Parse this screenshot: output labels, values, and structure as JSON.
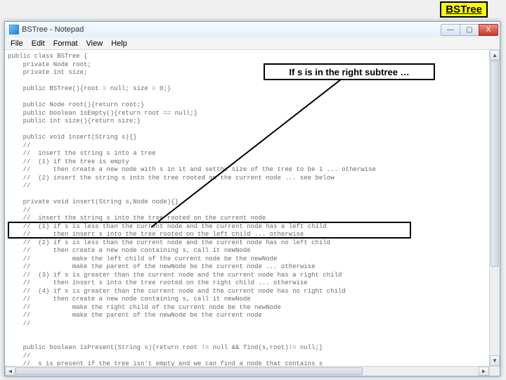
{
  "badge": "BSTree",
  "titlebar": {
    "title": "BSTree - Notepad"
  },
  "menu": {
    "file": "File",
    "edit": "Edit",
    "format": "Format",
    "view": "View",
    "help": "Help"
  },
  "winbuttons": {
    "min": "—",
    "max": "▢",
    "close": "X"
  },
  "annotation": "If s is in the right subtree …",
  "scroll": {
    "up": "▲",
    "down": "▼",
    "left": "◄",
    "right": "►"
  },
  "code_lines": [
    "public class BSTree {",
    "    private Node root;",
    "    private int size;",
    "",
    "    public BSTree(){root = null; size = 0;}",
    "",
    "    public Node root(){return root;}",
    "    public boolean isEmpty(){return root == null;}",
    "    public int size(){return size;}",
    "",
    "    public void insert(String s){}",
    "    //",
    "    //  insert the string s into a tree",
    "    //  (1) if the tree is empty",
    "    //      then create a new node with s in it and setthe size of the tree to be 1 ... otherwise",
    "    //  (2) insert the string s into the tree rooted on the current node ... see below",
    "    //",
    "",
    "    private void insert(String s,Node node){}",
    "    //",
    "    //  insert the string s into the tree rooted on the current node",
    "    //  (1) if s is less than the current node and the current node has a left child",
    "    //      then insert s into the tree rooted on the left child ... otherwise",
    "    //  (2) if s is less than the current node and the current node has no left child",
    "    //      then create a new node containing s, call it newNode",
    "    //           make the left child of the current node be the newNode",
    "    //           make the parent of the newNode be the current node ... otherwise",
    "    //  (3) if s is greater than the current node and the current node has a right child",
    "    //      then insert s into the tree rooted on the right child ... otherwise",
    "    //  (4) if s is greater than the current node and the current node has no right child",
    "    //      then create a new node containing s, call it newNode",
    "    //           make the right child of the current node be the newNode",
    "    //           make the parent of the newNode be the current node",
    "    //",
    "",
    "",
    "    public boolean isPresent(String s){return root != null && find(s,root)!= null;}",
    "    //",
    "    //  s is present if the tree isn't empty and we can find a node that contains s",
    "    //"
  ]
}
